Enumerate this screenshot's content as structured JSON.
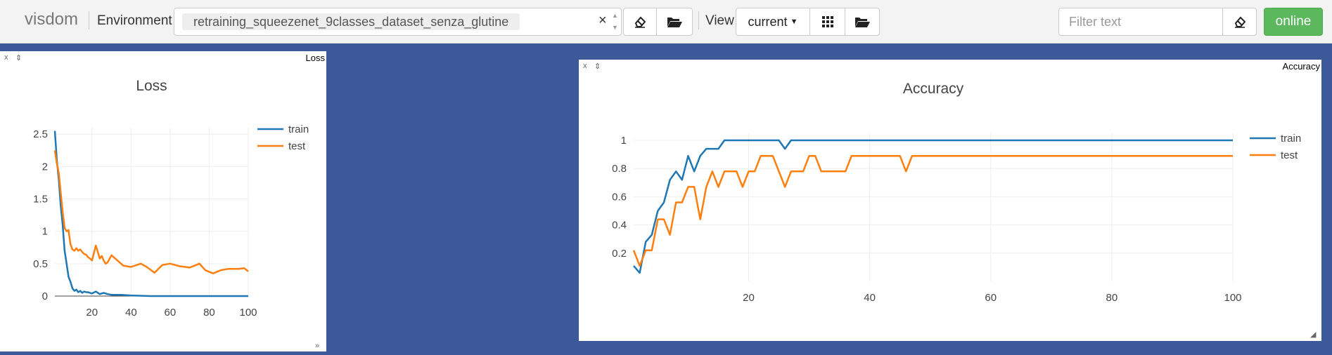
{
  "navbar": {
    "brand": "visdom",
    "env_label": "Environment",
    "env_value": "retraining_squeezenet_9classes_dataset_senza_glutine",
    "env_clear": "×",
    "view_label": "View",
    "view_value": "current",
    "filter_placeholder": "Filter text",
    "online_label": "online"
  },
  "panes": {
    "loss": {
      "window_title": "Loss",
      "close": "x",
      "pin": "⇕",
      "resize": "»"
    },
    "accuracy": {
      "window_title": "Accuracy",
      "close": "x",
      "pin": "⇕",
      "resize": "◢"
    }
  },
  "colors": {
    "train": "#1f77b4",
    "test": "#ff7f0e",
    "background": "#3c5a99",
    "online": "#5cb85c"
  },
  "chart_data": [
    {
      "type": "line",
      "title": "Loss",
      "xlabel": "",
      "ylabel": "",
      "xlim": [
        1,
        100
      ],
      "ylim": [
        0,
        2.6
      ],
      "xticks": [
        20,
        40,
        60,
        80,
        100
      ],
      "yticks": [
        0,
        0.5,
        1,
        1.5,
        2,
        2.5
      ],
      "ytick_labels": [
        "0",
        "0.5",
        "1",
        "1.5",
        "2",
        "2.5"
      ],
      "grid": true,
      "legend": "top-right",
      "series": [
        {
          "name": "train",
          "x": [
            1,
            2,
            3,
            4,
            5,
            6,
            7,
            8,
            9,
            10,
            11,
            12,
            13,
            14,
            15,
            16,
            17,
            18,
            19,
            20,
            22,
            24,
            26,
            28,
            30,
            35,
            40,
            50,
            60,
            70,
            80,
            90,
            100
          ],
          "y": [
            2.55,
            2.1,
            1.8,
            1.4,
            1.1,
            0.7,
            0.5,
            0.3,
            0.22,
            0.12,
            0.08,
            0.1,
            0.06,
            0.08,
            0.05,
            0.07,
            0.06,
            0.06,
            0.05,
            0.04,
            0.07,
            0.03,
            0.05,
            0.03,
            0.02,
            0.02,
            0.01,
            0.0,
            0.0,
            0.0,
            0.0,
            0.0,
            0.0
          ]
        },
        {
          "name": "test",
          "x": [
            1,
            2,
            3,
            4,
            5,
            6,
            7,
            8,
            9,
            10,
            11,
            12,
            13,
            14,
            15,
            16,
            17,
            18,
            19,
            20,
            22,
            24,
            25,
            26,
            27,
            28,
            30,
            33,
            36,
            40,
            45,
            48,
            52,
            56,
            60,
            65,
            70,
            75,
            78,
            82,
            86,
            90,
            95,
            98,
            100
          ],
          "y": [
            2.25,
            2.05,
            1.9,
            1.6,
            1.3,
            1.05,
            1.0,
            1.02,
            0.8,
            0.72,
            0.7,
            0.74,
            0.7,
            0.72,
            0.68,
            0.65,
            0.64,
            0.6,
            0.58,
            0.55,
            0.78,
            0.58,
            0.62,
            0.55,
            0.5,
            0.52,
            0.63,
            0.55,
            0.47,
            0.45,
            0.5,
            0.45,
            0.36,
            0.48,
            0.5,
            0.46,
            0.44,
            0.5,
            0.4,
            0.35,
            0.4,
            0.42,
            0.42,
            0.43,
            0.38
          ]
        }
      ]
    },
    {
      "type": "line",
      "title": "Accuracy",
      "xlabel": "",
      "ylabel": "",
      "xlim": [
        1,
        100
      ],
      "ylim": [
        0.0,
        1.05
      ],
      "xticks": [
        20,
        40,
        60,
        80,
        100
      ],
      "yticks": [
        0.2,
        0.4,
        0.6,
        0.8,
        1
      ],
      "ytick_labels": [
        "0.2",
        "0.4",
        "0.6",
        "0.8",
        "1"
      ],
      "grid": true,
      "legend": "top-right",
      "series": [
        {
          "name": "train",
          "x": [
            1,
            2,
            3,
            4,
            5,
            6,
            7,
            8,
            9,
            10,
            11,
            12,
            13,
            14,
            15,
            16,
            17,
            18,
            19,
            20,
            21,
            22,
            23,
            24,
            25,
            26,
            27,
            28,
            29,
            30,
            40,
            50,
            60,
            70,
            80,
            90,
            100
          ],
          "y": [
            0.11,
            0.06,
            0.28,
            0.33,
            0.5,
            0.56,
            0.72,
            0.78,
            0.72,
            0.89,
            0.78,
            0.89,
            0.94,
            0.94,
            0.94,
            1.0,
            1.0,
            1.0,
            1.0,
            1.0,
            1.0,
            1.0,
            1.0,
            1.0,
            1.0,
            0.94,
            1.0,
            1.0,
            1.0,
            1.0,
            1.0,
            1.0,
            1.0,
            1.0,
            1.0,
            1.0,
            1.0
          ]
        },
        {
          "name": "test",
          "x": [
            1,
            2,
            3,
            4,
            5,
            6,
            7,
            8,
            9,
            10,
            11,
            12,
            13,
            14,
            15,
            16,
            17,
            18,
            19,
            20,
            21,
            22,
            23,
            24,
            25,
            26,
            27,
            28,
            29,
            30,
            31,
            32,
            33,
            34,
            35,
            36,
            37,
            38,
            40,
            42,
            44,
            45,
            46,
            47,
            48,
            50,
            60,
            70,
            80,
            90,
            100
          ],
          "y": [
            0.22,
            0.11,
            0.22,
            0.22,
            0.44,
            0.44,
            0.33,
            0.56,
            0.56,
            0.67,
            0.67,
            0.44,
            0.67,
            0.78,
            0.67,
            0.78,
            0.78,
            0.78,
            0.67,
            0.78,
            0.78,
            0.89,
            0.89,
            0.89,
            0.78,
            0.67,
            0.78,
            0.78,
            0.78,
            0.89,
            0.89,
            0.78,
            0.78,
            0.78,
            0.78,
            0.78,
            0.89,
            0.89,
            0.89,
            0.89,
            0.89,
            0.89,
            0.78,
            0.89,
            0.89,
            0.89,
            0.89,
            0.89,
            0.89,
            0.89,
            0.89
          ]
        }
      ]
    }
  ]
}
